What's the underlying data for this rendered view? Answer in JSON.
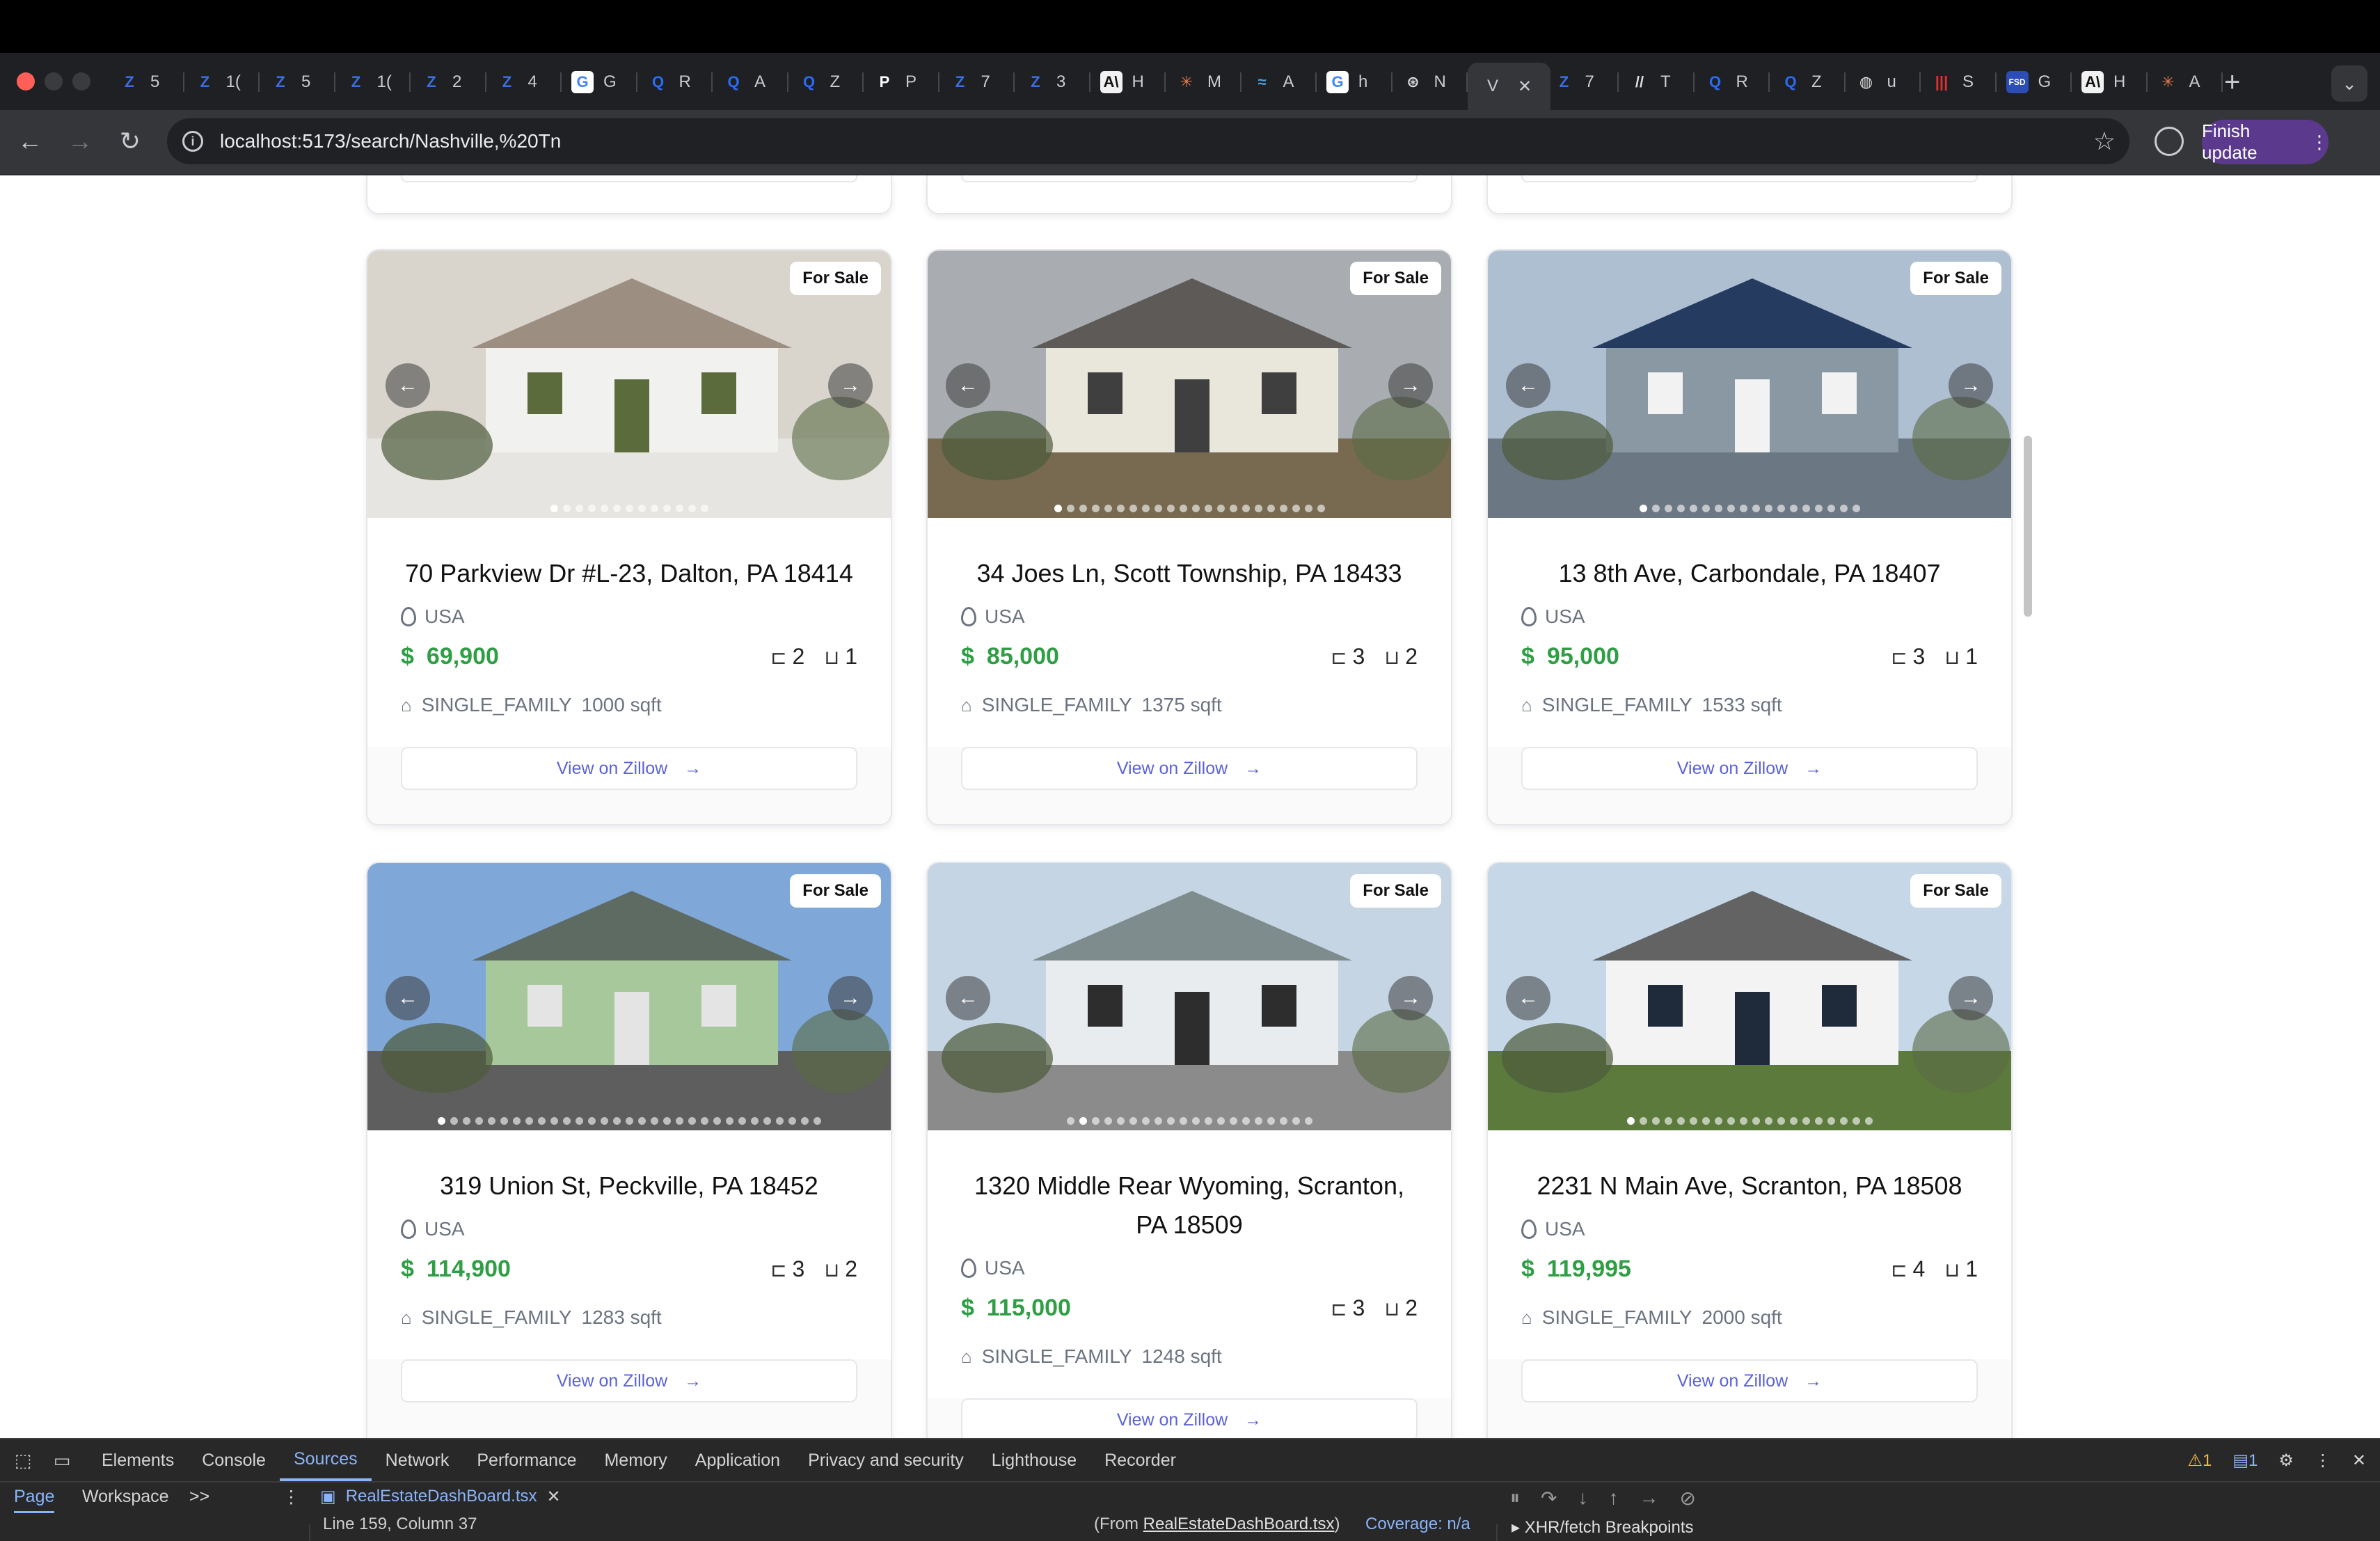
{
  "browser": {
    "tabs": [
      {
        "label": "5",
        "icon": "zillow-icon"
      },
      {
        "label": "1(",
        "icon": "zillow-icon"
      },
      {
        "label": "5",
        "icon": "zillow-icon"
      },
      {
        "label": "1(",
        "icon": "zillow-icon"
      },
      {
        "label": "2",
        "icon": "zillow-icon"
      },
      {
        "label": "4",
        "icon": "zillow-icon"
      },
      {
        "label": "G",
        "icon": "google-icon"
      },
      {
        "label": "R",
        "icon": "search-q-icon"
      },
      {
        "label": "A",
        "icon": "search-q-icon"
      },
      {
        "label": "Z",
        "icon": "search-q-icon"
      },
      {
        "label": "P",
        "icon": "p-icon"
      },
      {
        "label": "7",
        "icon": "zillow-icon"
      },
      {
        "label": "3",
        "icon": "zillow-icon"
      },
      {
        "label": "H",
        "icon": "anthropic-icon"
      },
      {
        "label": "M",
        "icon": "claude-icon"
      },
      {
        "label": "A",
        "icon": "wave-icon"
      },
      {
        "label": "h",
        "icon": "google-icon"
      },
      {
        "label": "N",
        "icon": "openai-icon"
      },
      {
        "label": "V",
        "icon": "vite-icon"
      },
      {
        "label": "7",
        "icon": "zillow-icon"
      },
      {
        "label": "T",
        "icon": "slash-icon"
      },
      {
        "label": "R",
        "icon": "search-q-icon"
      },
      {
        "label": "Z",
        "icon": "search-q-icon"
      },
      {
        "label": "u",
        "icon": "globe-icon"
      },
      {
        "label": "S",
        "icon": "stripes-icon"
      },
      {
        "label": "G",
        "icon": "fsd-icon"
      },
      {
        "label": "H",
        "icon": "anthropic-icon"
      },
      {
        "label": "A",
        "icon": "claude-icon"
      }
    ],
    "fav_text": {
      "zillow": "Z",
      "google": "G",
      "q": "Q",
      "p": "P",
      "anthropic": "A\\",
      "claude": "✳",
      "wave": "≈",
      "openai": "⊛",
      "slash": "//",
      "globe": "◍",
      "stripes": "|||",
      "fsd": "FSD"
    },
    "active_tab_close": "✕",
    "url": "localhost:5173/search/Nashville,%20Tn",
    "finish_update": "Finish update"
  },
  "badge_label": "For Sale",
  "location_label": "USA",
  "currency_symbol": "$",
  "zillow_button_label": "View on Zillow",
  "listings": [
    {
      "address": "70 Parkview Dr #L-23, Dalton, PA 18414",
      "price": "69,900",
      "beds": "2",
      "baths": "1",
      "type": "SINGLE_FAMILY",
      "sqft": "1000 sqft",
      "photo_count": 13,
      "photo_index": 0
    },
    {
      "address": "34 Joes Ln, Scott Township, PA 18433",
      "price": "85,000",
      "beds": "3",
      "baths": "2",
      "type": "SINGLE_FAMILY",
      "sqft": "1375 sqft",
      "photo_count": 22,
      "photo_index": 0
    },
    {
      "address": "13 8th Ave, Carbondale, PA 18407",
      "price": "95,000",
      "beds": "3",
      "baths": "1",
      "type": "SINGLE_FAMILY",
      "sqft": "1533 sqft",
      "photo_count": 18,
      "photo_index": 0
    },
    {
      "address": "319 Union St, Peckville, PA 18452",
      "price": "114,900",
      "beds": "3",
      "baths": "2",
      "type": "SINGLE_FAMILY",
      "sqft": "1283 sqft",
      "photo_count": 31,
      "photo_index": 0
    },
    {
      "address": "1320 Middle Rear Wyoming, Scranton, PA 18509",
      "price": "115,000",
      "beds": "3",
      "baths": "2",
      "type": "SINGLE_FAMILY",
      "sqft": "1248 sqft",
      "photo_count": 20,
      "photo_index": 1
    },
    {
      "address": "2231 N Main Ave, Scranton, PA 18508",
      "price": "119,995",
      "beds": "4",
      "baths": "1",
      "type": "SINGLE_FAMILY",
      "sqft": "2000 sqft",
      "photo_count": 20,
      "photo_index": 0
    }
  ],
  "devtools": {
    "tabs": [
      "Elements",
      "Console",
      "Sources",
      "Network",
      "Performance",
      "Memory",
      "Application",
      "Privacy and security",
      "Lighthouse",
      "Recorder"
    ],
    "active_tab": "Sources",
    "warnings": "1",
    "messages": "1",
    "subtabs": [
      "Page",
      "Workspace"
    ],
    "more": ">>",
    "file_tab": "RealEstateDashBoard.tsx",
    "status": "Line 159, Column 37",
    "from_prefix": "(From ",
    "from_file": "RealEstateDashBoard.tsx",
    "from_suffix": ")",
    "coverage": "Coverage: n/a",
    "xhr": "XHR/fetch Breakpoints"
  }
}
